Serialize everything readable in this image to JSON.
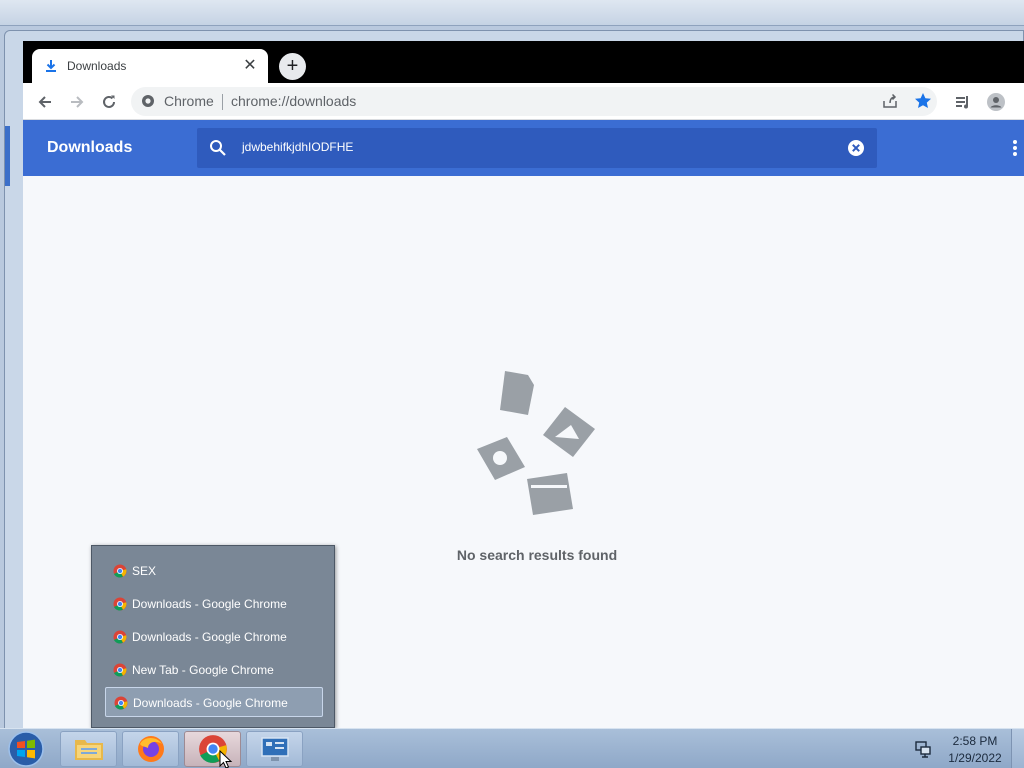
{
  "browser": {
    "tab_title": "Downloads",
    "tab_close": "✕",
    "new_tab": "+",
    "site_label": "Chrome",
    "url": "chrome://downloads"
  },
  "downloads": {
    "title": "Downloads",
    "search_query": "jdwbehifkjdhIODFHE",
    "empty_message": "No search results found"
  },
  "jump_list": {
    "items": [
      {
        "label": "SEX"
      },
      {
        "label": "Downloads - Google Chrome"
      },
      {
        "label": "Downloads - Google Chrome"
      },
      {
        "label": "New Tab - Google Chrome"
      },
      {
        "label": "Downloads - Google Chrome",
        "selected": true
      }
    ]
  },
  "taskbar": {
    "apps": [
      "file-explorer",
      "firefox",
      "chrome",
      "control-panel"
    ],
    "clock_time": "2:58 PM",
    "clock_date": "1/29/2022"
  },
  "colors": {
    "accent": "#3b6dd3",
    "search_bg": "#2f5bbd",
    "star": "#1a73e8"
  }
}
